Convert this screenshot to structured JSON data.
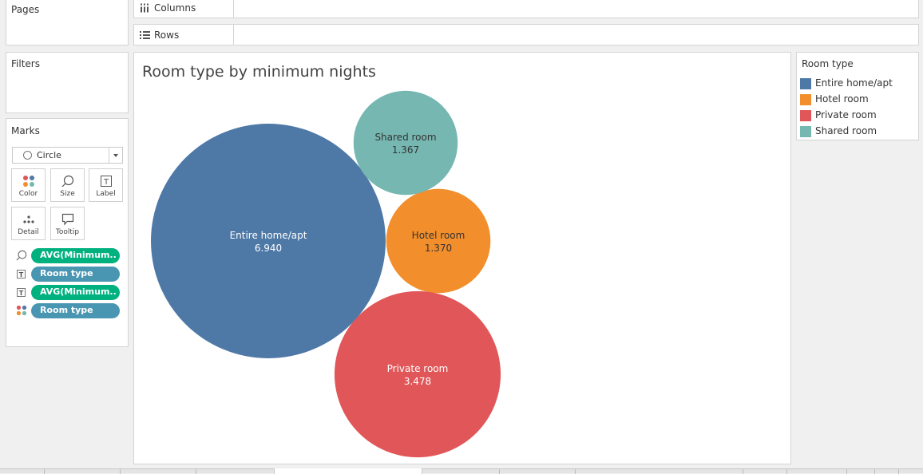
{
  "shelves": {
    "columns": {
      "label": "Columns"
    },
    "rows": {
      "label": "Rows"
    }
  },
  "pages": {
    "title": "Pages"
  },
  "filters": {
    "title": "Filters"
  },
  "marks": {
    "title": "Marks",
    "mark_type": "Circle",
    "buttons": {
      "color": "Color",
      "size": "Size",
      "label": "Label",
      "detail": "Detail",
      "tooltip": "Tooltip"
    },
    "pills": [
      {
        "icon": "size-icon",
        "text": "AVG(Minimum..",
        "color": "green"
      },
      {
        "icon": "label-icon",
        "text": "Room type",
        "color": "blue"
      },
      {
        "icon": "label-icon",
        "text": "AVG(Minimum..",
        "color": "green"
      },
      {
        "icon": "color-icon",
        "text": "Room type",
        "color": "blue"
      }
    ]
  },
  "sheet": {
    "title": "Room type by minimum nights"
  },
  "legend": {
    "title": "Room type",
    "items": [
      {
        "label": "Entire home/apt",
        "color": "#4e79a7"
      },
      {
        "label": "Hotel room",
        "color": "#f28e2b"
      },
      {
        "label": "Private room",
        "color": "#e15759"
      },
      {
        "label": "Shared room",
        "color": "#76b7b2"
      }
    ]
  },
  "chart_data": {
    "type": "packed-bubble",
    "title": "Room type by minimum nights",
    "size_measure": "AVG(Minimum..",
    "color_dimension": "Room type",
    "categories": [
      "Entire home/apt",
      "Hotel room",
      "Private room",
      "Shared room"
    ],
    "values": [
      6.94,
      1.37,
      3.478,
      1.367
    ],
    "labels": [
      "6.940",
      "1.370",
      "3.478",
      "1.367"
    ],
    "colors": [
      "#4e79a7",
      "#f28e2b",
      "#e15759",
      "#76b7b2"
    ]
  }
}
